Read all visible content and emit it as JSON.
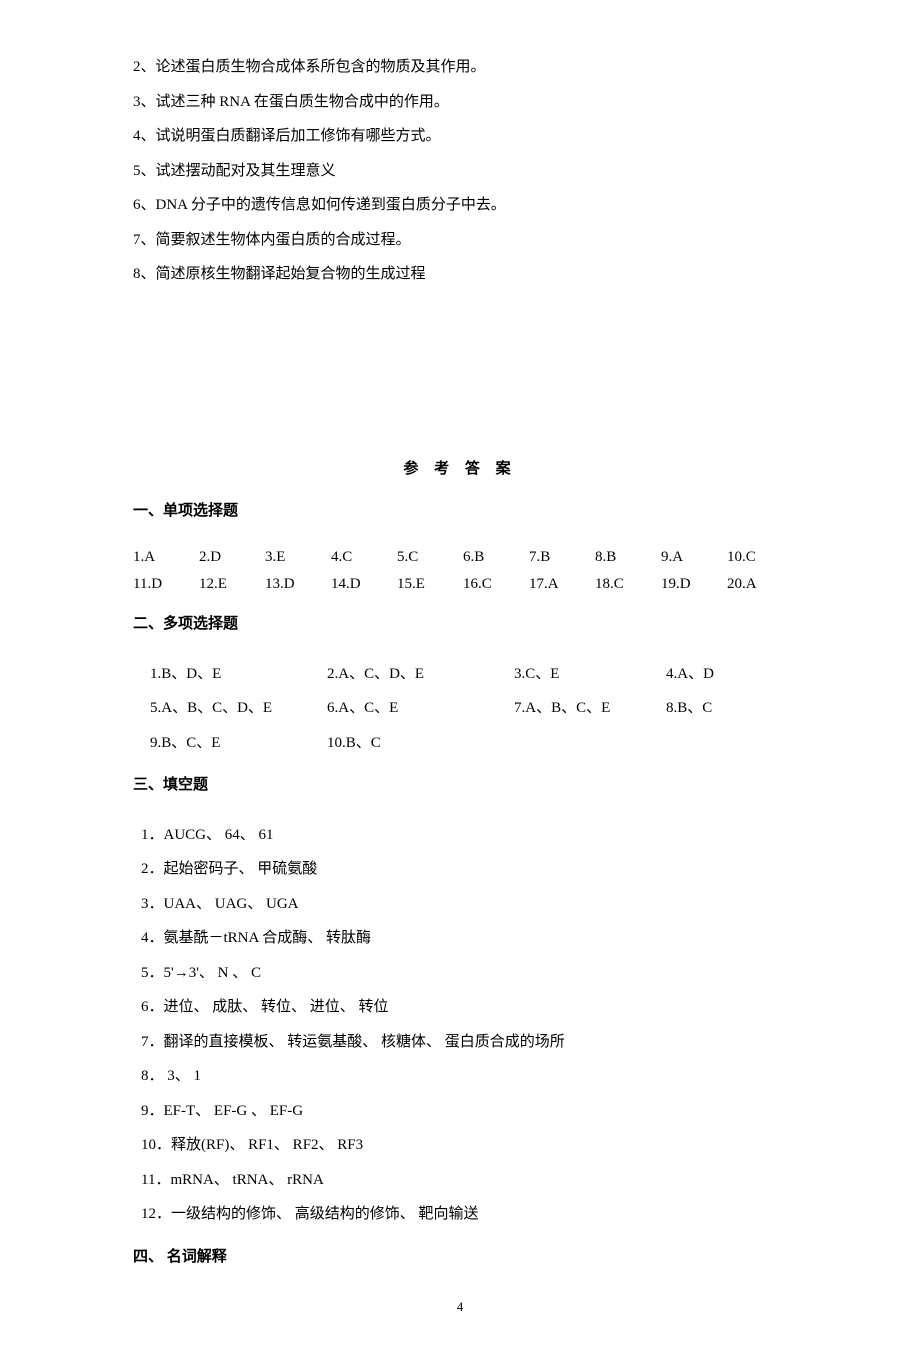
{
  "essay_questions": [
    "2、论述蛋白质生物合成体系所包含的物质及其作用。",
    "3、试述三种 RNA 在蛋白质生物合成中的作用。",
    "4、试说明蛋白质翻译后加工修饰有哪些方式。",
    "5、试述摆动配对及其生理意义",
    "6、DNA 分子中的遗传信息如何传递到蛋白质分子中去。",
    "7、简要叙述生物体内蛋白质的合成过程。",
    "8、简述原核生物翻译起始复合物的生成过程"
  ],
  "answer_title": "参 考 答 案",
  "sections": {
    "single": "一、单项选择题",
    "multi": "二、多项选择题",
    "fill": "三、填空题",
    "terms": "四、 名词解释"
  },
  "single_answers": {
    "row1": [
      "1.A",
      "2.D",
      "3.E",
      "4.C",
      "5.C",
      "6.B",
      "7.B",
      "8.B",
      "9.A",
      "10.C"
    ],
    "row2": [
      "11.D",
      "12.E",
      "13.D",
      "14.D",
      "15.E",
      "16.C",
      "17.A",
      "18.C",
      "19.D",
      "20.A"
    ]
  },
  "multi_answers": {
    "row1": [
      "1.B、D、E",
      "2.A、C、D、E",
      "3.C、E",
      "4.A、D"
    ],
    "row2": [
      "5.A、B、C、D、E",
      "6.A、C、E",
      "7.A、B、C、E",
      "8.B、C"
    ],
    "row3": [
      "9.B、C、E",
      "10.B、C",
      "",
      ""
    ]
  },
  "fill_answers": [
    "1．AUCG、 64、 61",
    "2．起始密码子、 甲硫氨酸",
    "3．UAA、 UAG、 UGA",
    "4．氨基酰－tRNA 合成酶、 转肽酶",
    "5．5'→3'、   N 、 C",
    "6．进位、 成肽、 转位、  进位、 转位",
    "7．翻译的直接模板、 转运氨基酸、 核糖体、 蛋白质合成的场所",
    "8． 3、 1",
    "9．EF-T、 EF-G 、 EF-G",
    "10．释放(RF)、 RF1、 RF2、 RF3",
    "11．mRNA、  tRNA、 rRNA",
    "12．一级结构的修饰、 高级结构的修饰、 靶向输送"
  ],
  "page_number": "4"
}
